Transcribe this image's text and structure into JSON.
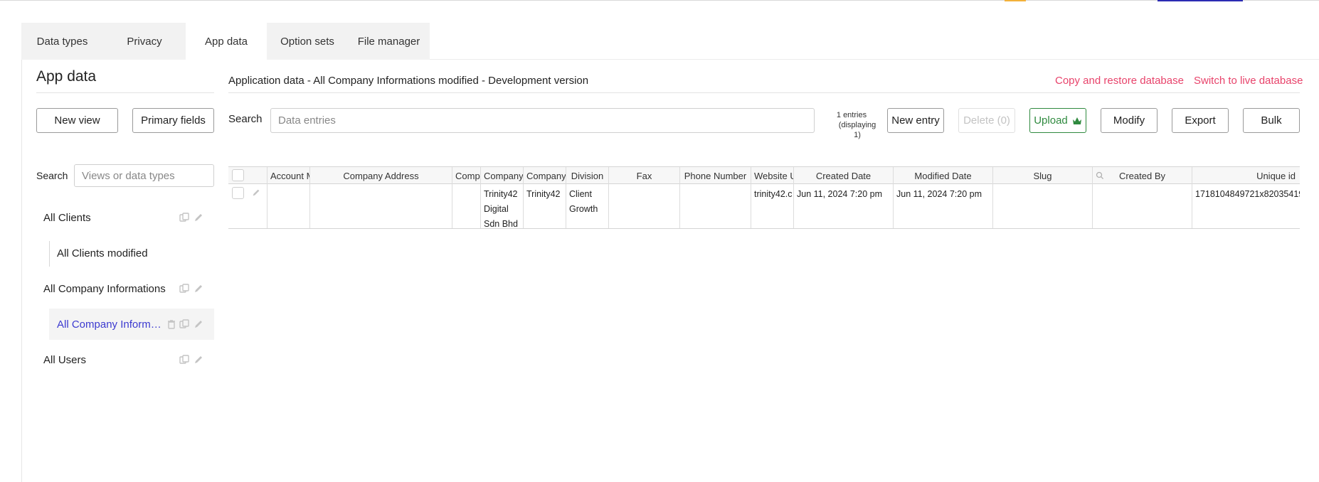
{
  "tabs": [
    "Data types",
    "Privacy",
    "App data",
    "Option sets",
    "File manager"
  ],
  "left_panel": {
    "title": "App data",
    "new_view_label": "New view",
    "primary_fields_label": "Primary fields",
    "search_label": "Search",
    "search_placeholder": "Views or data types",
    "views": [
      {
        "name": "All Clients"
      },
      {
        "name": "All Clients modified"
      },
      {
        "name": "All Company Informations"
      },
      {
        "name": "All Company Informations modified"
      },
      {
        "name": "All Users"
      }
    ]
  },
  "main": {
    "title": "Application data - All Company Informations modified - Development version",
    "copy_restore_label": "Copy and restore database",
    "switch_live_label": "Switch to live database",
    "search_label": "Search",
    "search_placeholder": "Data entries",
    "entries_line1": "1 entries",
    "entries_line2": "(displaying",
    "entries_line3": "1)",
    "new_entry_label": "New entry",
    "delete_label": "Delete (0)",
    "upload_label": "Upload",
    "modify_label": "Modify",
    "export_label": "Export",
    "bulk_label": "Bulk"
  },
  "table": {
    "columns": [
      "Account M",
      "Company Address",
      "Compa",
      "Company",
      "Company",
      "Division",
      "Fax",
      "Phone Number",
      "Website U",
      "Created Date",
      "Modified Date",
      "Slug",
      "Created By",
      "Unique id"
    ],
    "row": {
      "company_name_1": "Trinity42",
      "company_name_2": "Digital",
      "company_name_3": "Sdn Bhd",
      "company_short": "Trinity42",
      "division_1": "Client",
      "division_2": "Growth",
      "website": "trinity42.c",
      "created_date": "Jun 11, 2024 7:20 pm",
      "modified_date": "Jun 11, 2024 7:20 pm",
      "unique_id": "1718104849721x82035419"
    }
  },
  "colors": {
    "accent_red": "#e8436b",
    "selected_view": "#3c3ad0",
    "upload_green": "#2f8a3f",
    "top_accent_orange": "#f3b13b",
    "top_accent_blue": "#2b2bb3"
  }
}
